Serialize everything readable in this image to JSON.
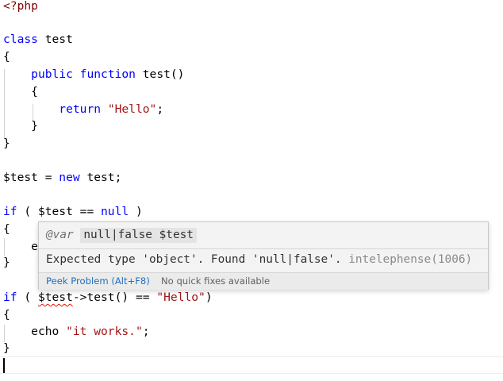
{
  "code": {
    "php_open": "<?php",
    "kw_class": "class",
    "class_name": " test",
    "brace_open": "{",
    "brace_close": "}",
    "kw_public": "public",
    "kw_function": "function",
    "method_sig": " test()",
    "kw_return": "return",
    "str_hello": "\"Hello\"",
    "semicolon": ";",
    "var_test": "$test",
    "assign": " = ",
    "kw_new": "new",
    "new_target": " test;",
    "kw_if": "if",
    "if1_open": " ( ",
    "if1_cond": "$test == ",
    "kw_null": "null",
    "if1_close": " )",
    "partial_echo": "e",
    "if2_open": " ( ",
    "if2_var": "$test",
    "if2_call": "->test() == ",
    "if2_close": ")",
    "echo_kw": "echo ",
    "str_works": "\"it works.\""
  },
  "hover": {
    "annotation": "@var",
    "type_signature": "null|false $test",
    "message": "Expected type 'object'. Found 'null|false'.",
    "source": "intelephense(1006)",
    "peek_label": "Peek Problem (Alt+F8)",
    "no_fix_label": "No quick fixes available"
  }
}
